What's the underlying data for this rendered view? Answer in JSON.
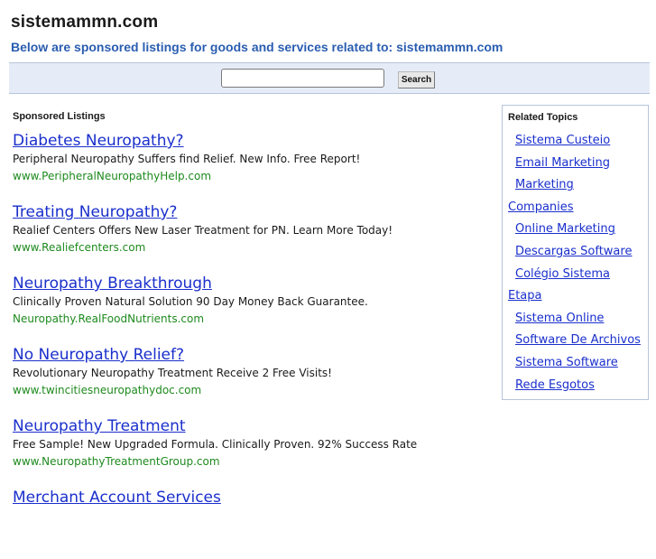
{
  "header": {
    "site_title": "sistemammn.com",
    "subtitle": "Below are sponsored listings for goods and services related to: sistemammn.com"
  },
  "search": {
    "value": "",
    "button_label": "Search"
  },
  "sponsored": {
    "heading": "Sponsored Listings",
    "listings": [
      {
        "title": "Diabetes Neuropathy?",
        "description": "Peripheral Neuropathy Suffers find Relief. New Info. Free Report!",
        "url": "www.PeripheralNeuropathyHelp.com"
      },
      {
        "title": "Treating Neuropathy?",
        "description": "Realief Centers Offers New Laser Treatment for PN. Learn More Today!",
        "url": "www.Realiefcenters.com"
      },
      {
        "title": "Neuropathy Breakthrough",
        "description": "Clinically Proven Natural Solution 90 Day Money Back Guarantee.",
        "url": "Neuropathy.RealFoodNutrients.com"
      },
      {
        "title": "No Neuropathy Relief?",
        "description": "Revolutionary Neuropathy Treatment Receive 2 Free Visits!",
        "url": "www.twincitiesneuropathydoc.com"
      },
      {
        "title": "Neuropathy Treatment",
        "description": "Free Sample! New Upgraded Formula. Clinically Proven. 92% Success Rate",
        "url": "www.NeuropathyTreatmentGroup.com"
      },
      {
        "title": "Merchant Account Services",
        "description": "",
        "url": ""
      }
    ]
  },
  "related": {
    "heading": "Related Topics",
    "items": [
      {
        "label": "Sistema Custeio",
        "indent": true
      },
      {
        "label": "Email Marketing",
        "indent": true
      },
      {
        "label": "Marketing",
        "indent": true
      },
      {
        "label": "Companies",
        "indent": false
      },
      {
        "label": "Online Marketing",
        "indent": true
      },
      {
        "label": "Descargas Software",
        "indent": true
      },
      {
        "label": "Colégio Sistema",
        "indent": true
      },
      {
        "label": "Etapa",
        "indent": false
      },
      {
        "label": "Sistema Online",
        "indent": true
      },
      {
        "label": "Software De Archivos",
        "indent": true
      },
      {
        "label": "Sistema Software",
        "indent": true
      },
      {
        "label": "Rede Esgotos",
        "indent": true
      }
    ]
  }
}
